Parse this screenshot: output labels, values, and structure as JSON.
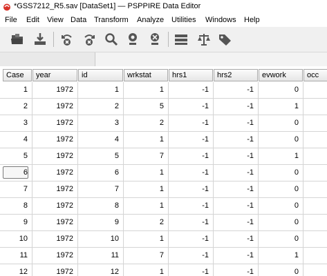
{
  "window": {
    "title": "*GSS7212_R5.sav [DataSet1] — PSPPIRE Data Editor"
  },
  "menu": [
    "File",
    "Edit",
    "View",
    "Data",
    "Transform",
    "Analyze",
    "Utilities",
    "Windows",
    "Help"
  ],
  "toolbar": {
    "icons": [
      "open-icon",
      "save-icon",
      "undo-icon",
      "redo-icon",
      "find-icon",
      "goto-case-icon",
      "goto-variable-icon",
      "insert-case-icon",
      "split-file-icon",
      "value-labels-icon",
      "select-cases-icon",
      "weight-cases-icon"
    ]
  },
  "columns": [
    "Case",
    "year",
    "id",
    "wrkstat",
    "hrs1",
    "hrs2",
    "evwork",
    "occ"
  ],
  "rows": [
    [
      "1",
      "1972",
      "1",
      "1",
      "-1",
      "-1",
      "0",
      ""
    ],
    [
      "2",
      "1972",
      "2",
      "5",
      "-1",
      "-1",
      "1",
      ""
    ],
    [
      "3",
      "1972",
      "3",
      "2",
      "-1",
      "-1",
      "0",
      ""
    ],
    [
      "4",
      "1972",
      "4",
      "1",
      "-1",
      "-1",
      "0",
      ""
    ],
    [
      "5",
      "1972",
      "5",
      "7",
      "-1",
      "-1",
      "1",
      ""
    ],
    [
      "6",
      "1972",
      "6",
      "1",
      "-1",
      "-1",
      "0",
      ""
    ],
    [
      "7",
      "1972",
      "7",
      "1",
      "-1",
      "-1",
      "0",
      ""
    ],
    [
      "8",
      "1972",
      "8",
      "1",
      "-1",
      "-1",
      "0",
      ""
    ],
    [
      "9",
      "1972",
      "9",
      "2",
      "-1",
      "-1",
      "0",
      ""
    ],
    [
      "10",
      "1972",
      "10",
      "1",
      "-1",
      "-1",
      "0",
      ""
    ],
    [
      "11",
      "1972",
      "11",
      "7",
      "-1",
      "-1",
      "1",
      ""
    ],
    [
      "12",
      "1972",
      "12",
      "1",
      "-1",
      "-1",
      "0",
      ""
    ]
  ],
  "selected_case": "6"
}
